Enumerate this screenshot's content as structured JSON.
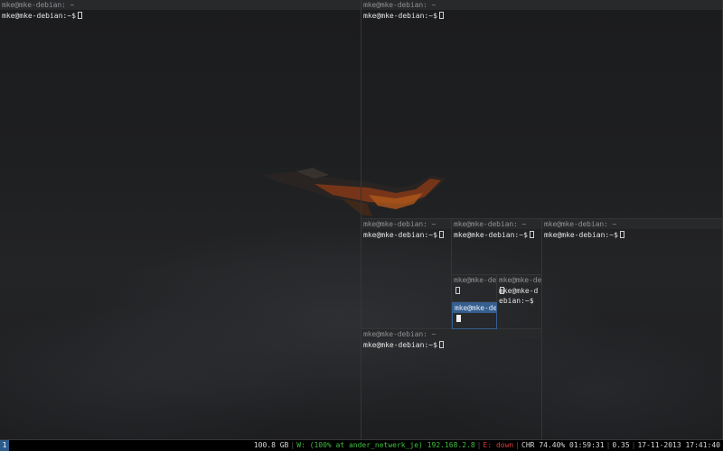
{
  "colors": {
    "title_bar": "#28292b",
    "title_text": "#8e9093",
    "focused_title": "#355f8f",
    "prompt_text": "#e4e4e4",
    "status_bg": "#000000",
    "wifi_green": "#3fbf3f",
    "eth_red": "#e03c3c",
    "workspace_blue": "#2c5c8c"
  },
  "terminals": {
    "top_left": {
      "title": "mke@mke-debian: ~",
      "prompt": "mke@mke-debian:~$"
    },
    "top_right": {
      "title": "mke@mke-debian: ~",
      "prompt": "mke@mke-debian:~$"
    },
    "mid_left": {
      "title": "mke@mke-debian: ~",
      "prompt": "mke@mke-debian:~$"
    },
    "mid_center": {
      "title": "mke@mke-debian: ~",
      "prompt": "mke@mke-debian:~$"
    },
    "mid_right": {
      "title": "mke@mke-debian: ~",
      "prompt": "mke@mke-debian:~$"
    },
    "small_left": {
      "title": "mke@mke-deb"
    },
    "small_right": {
      "title": "mke@mke-deb",
      "prompt": "mke@mke-d\nebian:~$"
    },
    "small_focused": {
      "title": "mke@mke-deb"
    },
    "bottom": {
      "title": "mke@mke-debian: ~",
      "prompt": "mke@mke-debian:~$"
    }
  },
  "statusbar": {
    "workspace": "1",
    "disk": "100.8 GB",
    "wifi": "W: (100% at ander_netwerk_je) 192.168.2.8",
    "ethernet": "E: down",
    "battery": "CHR 74.40% 01:59:31",
    "load": "0.35",
    "datetime": "17-11-2013 17:41:40"
  }
}
